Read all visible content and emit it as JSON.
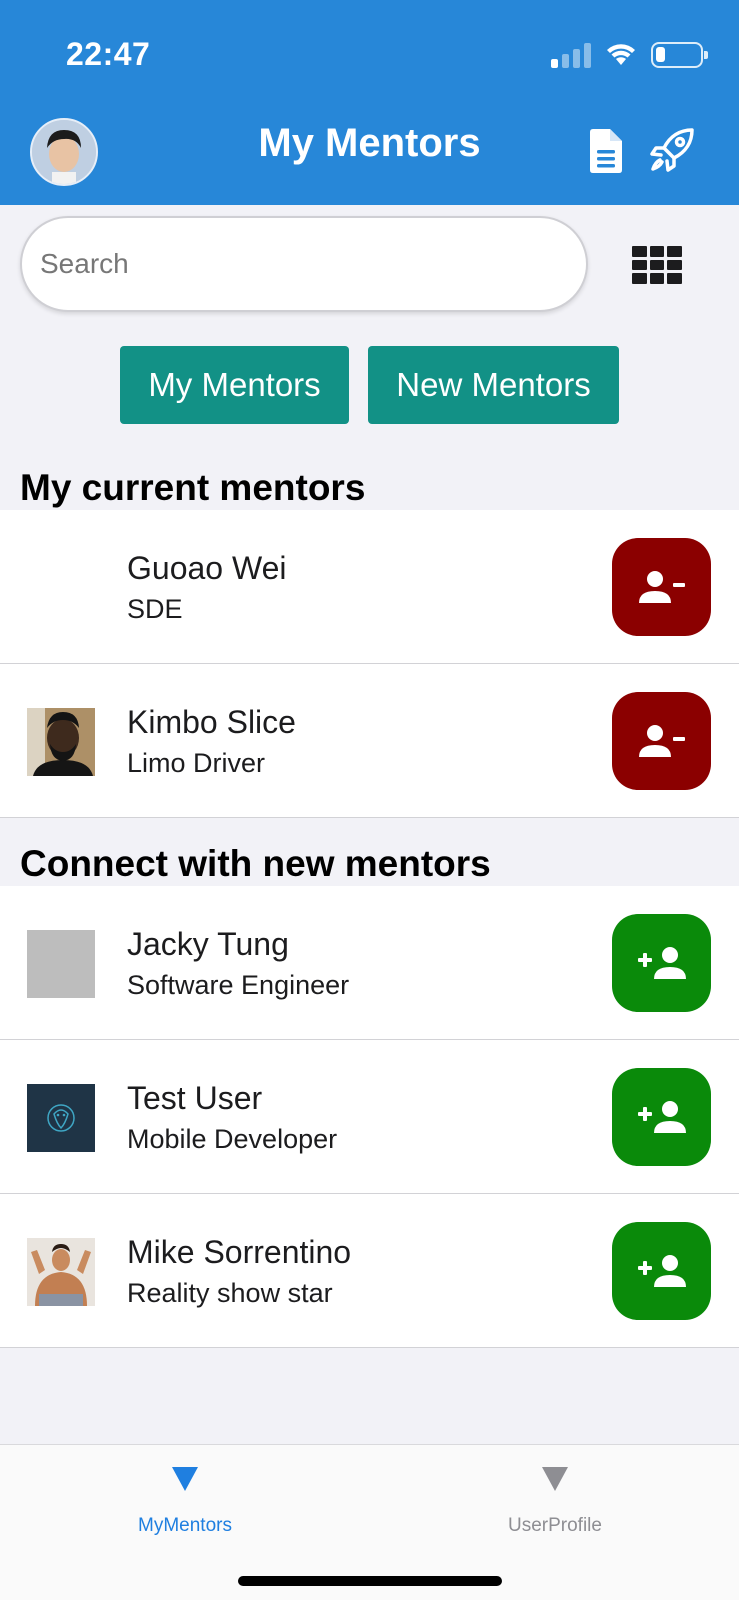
{
  "status_bar": {
    "time": "22:47"
  },
  "header": {
    "title": "My Mentors"
  },
  "search": {
    "placeholder": "Search"
  },
  "segments": {
    "my_label": "My Mentors",
    "new_label": "New Mentors"
  },
  "current_section": {
    "title": "My current mentors",
    "items": [
      {
        "name": "Guoao Wei",
        "role": "SDE",
        "photo": "none"
      },
      {
        "name": "Kimbo Slice",
        "role": "Limo Driver",
        "photo": "photo"
      }
    ]
  },
  "new_section": {
    "title": "Connect with new mentors",
    "items": [
      {
        "name": "Jacky Tung",
        "role": "Software Engineer",
        "photo": "placeholder"
      },
      {
        "name": "Test User",
        "role": "Mobile Developer",
        "photo": "logo"
      },
      {
        "name": "Mike Sorrentino",
        "role": "Reality show star",
        "photo": "photo"
      }
    ]
  },
  "tabbar": {
    "tab1_label": "MyMentors",
    "tab2_label": "UserProfile"
  },
  "icons": {
    "document": "document-icon",
    "rocket": "rocket-icon",
    "grid": "grid-icon",
    "remove_user": "person-remove-icon",
    "add_user": "person-add-icon"
  },
  "colors": {
    "header": "#2787d8",
    "segment_button": "#129186",
    "remove_button": "#8b0000",
    "add_button": "#0a8a0a",
    "active_tab": "#1f7fe0"
  }
}
